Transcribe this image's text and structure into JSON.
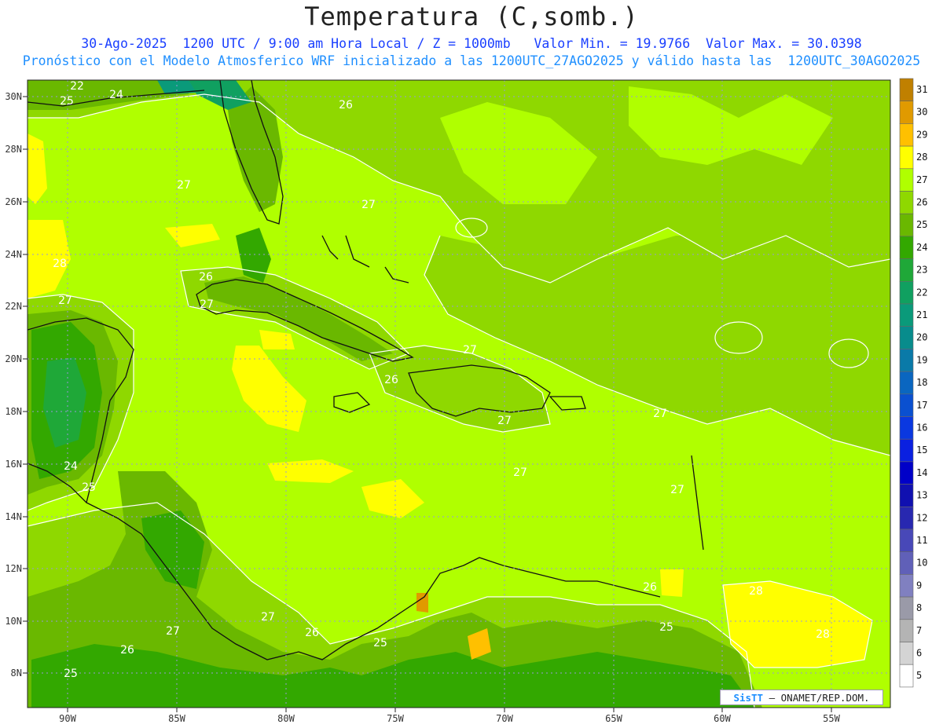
{
  "title": "Temperatura (C,somb.)",
  "subtitle_line1": "30-Ago-2025  1200 UTC / 9:00 am Hora Local / Z = 1000mb   Valor Min. = 19.9766  Valor Max. = 30.0398",
  "subtitle_line2": "Pronóstico con el Modelo Atmosferico WRF inicializado a las 1200UTC_27AGO2025 y válido hasta las  1200UTC_30AGO2025",
  "credit": {
    "brand": "SisTT",
    "text": "– ONAMET/REP.DOM."
  },
  "map": {
    "lat_ticks": [
      "30N",
      "28N",
      "26N",
      "24N",
      "22N",
      "20N",
      "18N",
      "16N",
      "14N",
      "12N",
      "10N",
      "8N"
    ],
    "lon_ticks": [
      "90W",
      "85W",
      "80W",
      "75W",
      "70W",
      "65W",
      "60W",
      "55W"
    ]
  },
  "colorbar": {
    "levels": [
      "31",
      "30",
      "29",
      "28",
      "27",
      "26",
      "25",
      "24",
      "23",
      "22",
      "21",
      "20",
      "19",
      "18",
      "17",
      "16",
      "15",
      "14",
      "13",
      "12",
      "11",
      "10",
      "9",
      "8",
      "7",
      "6",
      "5"
    ],
    "colors": [
      "#c08000",
      "#e09a00",
      "#ffc000",
      "#ffff00",
      "#b0ff00",
      "#8fd800",
      "#6ab800",
      "#33a800",
      "#1fa838",
      "#10a060",
      "#0a9a7a",
      "#088c8c",
      "#0a7aa8",
      "#0a66c0",
      "#0a50d0",
      "#0a38e0",
      "#0a20e0",
      "#0000c8",
      "#1010b0",
      "#2828b0",
      "#4848b8",
      "#6060b8",
      "#8080c0",
      "#9a9aa8",
      "#b4b4b4",
      "#d4d4d4",
      "#ffffff"
    ]
  },
  "contour_labels": [
    "22",
    "24",
    "25",
    "26",
    "27",
    "27",
    "28",
    "27",
    "26",
    "27",
    "27",
    "26",
    "27",
    "27",
    "27",
    "27",
    "26",
    "24",
    "25",
    "27",
    "26",
    "25",
    "27",
    "28",
    "28",
    "25",
    "26",
    "25"
  ]
}
